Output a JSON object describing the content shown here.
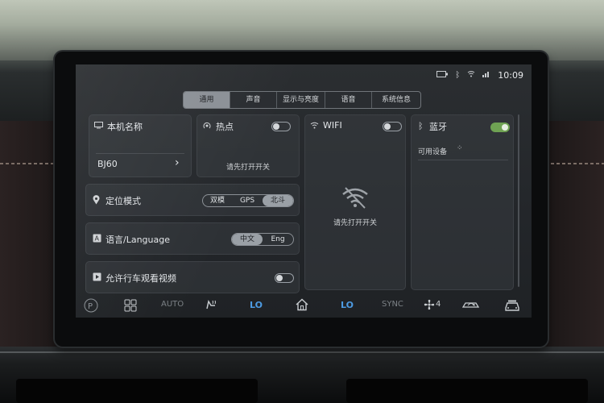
{
  "status": {
    "time": "10:09"
  },
  "tabs": [
    {
      "label": "通用",
      "active": true
    },
    {
      "label": "声音",
      "active": false
    },
    {
      "label": "显示与亮度",
      "active": false
    },
    {
      "label": "语音",
      "active": false
    },
    {
      "label": "系统信息",
      "active": false
    }
  ],
  "device_name": {
    "title": "本机名称",
    "value": "BJ60",
    "arrow": "›"
  },
  "hotspot": {
    "title": "热点",
    "enabled": false,
    "hint": "请先打开开关"
  },
  "wifi": {
    "title": "WIFI",
    "enabled": false,
    "hint": "请先打开开关"
  },
  "bluetooth": {
    "title": "蓝牙",
    "enabled": true,
    "available_label": "可用设备"
  },
  "positioning": {
    "title": "定位模式",
    "options": [
      "双模",
      "GPS",
      "北斗"
    ],
    "selected": "北斗"
  },
  "language": {
    "title": "语言/Language",
    "options": [
      "中文",
      "Eng"
    ],
    "selected": "中文"
  },
  "video": {
    "title": "允许行车观看视频",
    "enabled": false
  },
  "dock": {
    "auto_label": "AUTO",
    "left_temp": "LO",
    "right_temp": "LO",
    "sync_label": "SYNC",
    "fan_level": "4"
  },
  "colors": {
    "accent_blue": "#4d9be3",
    "toggle_on": "#6fa253"
  }
}
